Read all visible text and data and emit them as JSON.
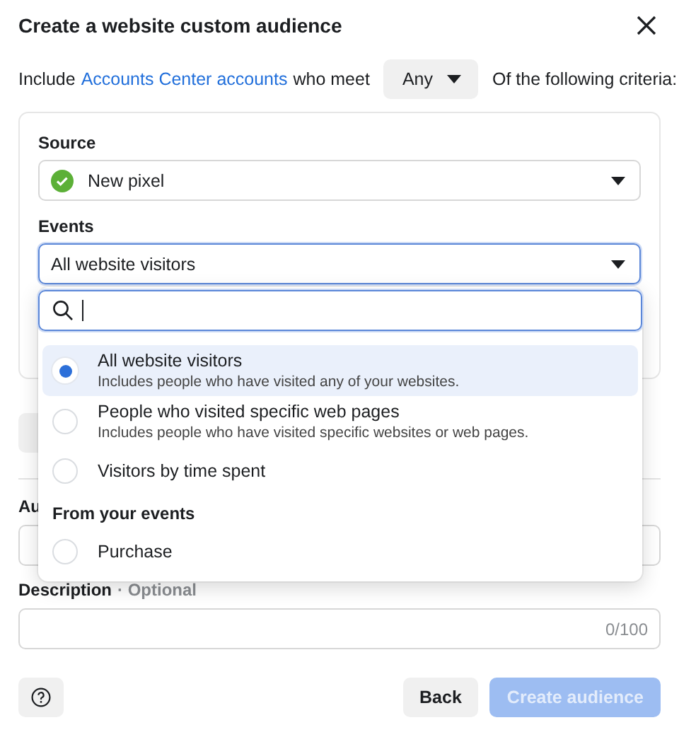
{
  "dialog": {
    "title": "Create a website custom audience"
  },
  "criteria_line": {
    "prefix": "Include",
    "link": "Accounts Center accounts",
    "middle": "who meet",
    "match": "Any",
    "suffix": "Of the following criteria:"
  },
  "source": {
    "label": "Source",
    "value": "New pixel"
  },
  "events": {
    "label": "Events",
    "value": "All website visitors"
  },
  "events_menu": {
    "items": [
      {
        "kind": "option",
        "title": "All website visitors",
        "subtitle": "Includes people who have visited any of your websites.",
        "selected": true
      },
      {
        "kind": "option",
        "title": "People who visited specific web pages",
        "subtitle": "Includes people who have visited specific websites or web pages.",
        "selected": false
      },
      {
        "kind": "option",
        "title": "Visitors by time spent",
        "selected": false
      },
      {
        "kind": "header",
        "title": "From your events"
      },
      {
        "kind": "option",
        "title": "Purchase",
        "selected": false
      }
    ]
  },
  "audience_name": {
    "label": "Au"
  },
  "description": {
    "label": "Description",
    "hint": "· Optional",
    "counter": "0/100"
  },
  "buttons": {
    "back": "Back",
    "create": {
      "label": "Create audience",
      "disabled": true
    }
  }
}
